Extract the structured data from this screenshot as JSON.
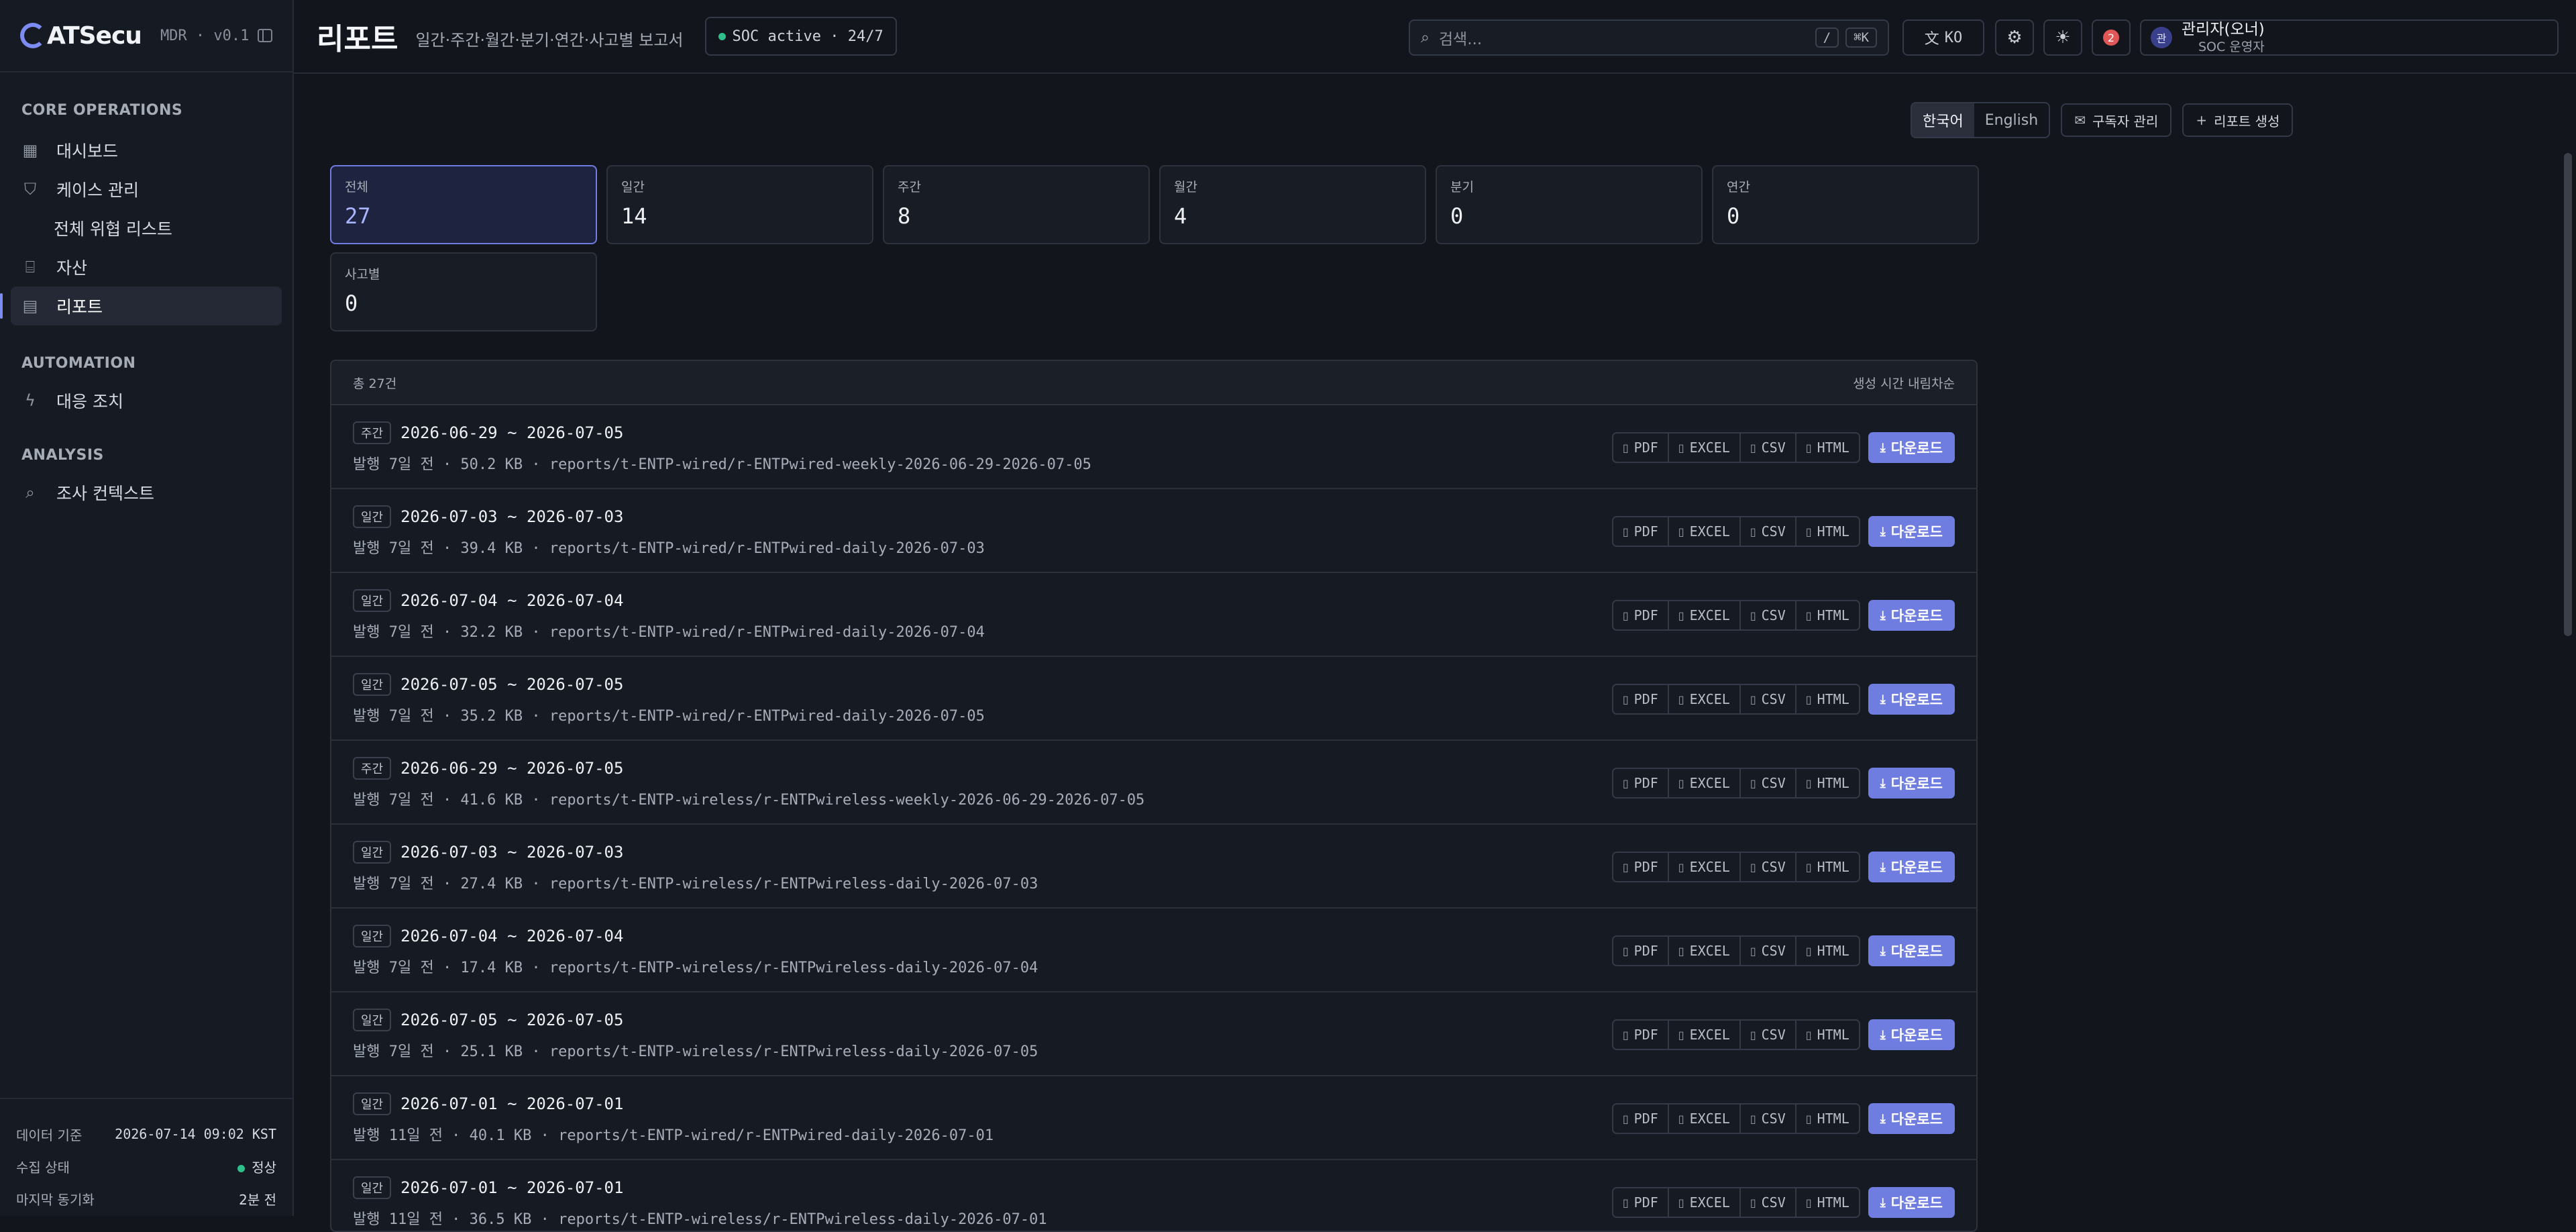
{
  "brand": {
    "name": "ATSecu",
    "version": "MDR · v0.1"
  },
  "sidebar": {
    "sections": [
      {
        "title": "CORE OPERATIONS"
      },
      {
        "title": "AUTOMATION"
      },
      {
        "title": "ANALYSIS"
      }
    ],
    "items": [
      {
        "label": "대시보드",
        "icon": "grid-icon"
      },
      {
        "label": "케이스 관리",
        "icon": "shield-icon"
      },
      {
        "label": "전체 위협 리스트"
      },
      {
        "label": "자산",
        "icon": "drive-icon"
      },
      {
        "label": "리포트",
        "icon": "report-icon",
        "active": true
      },
      {
        "label": "대응 조치",
        "icon": "bolt-icon"
      },
      {
        "label": "조사 컨텍스트",
        "icon": "search-icon"
      }
    ],
    "footer": {
      "data_label": "데이터 기준",
      "data_value": "2026-07-14 09:02 KST",
      "collect_label": "수집 상태",
      "collect_value": "정상",
      "sync_label": "마지막 동기화",
      "sync_value": "2분 전"
    }
  },
  "topbar": {
    "title": "리포트",
    "subtitle": "일간·주간·월간·분기·연간·사고별 보고서",
    "soc_badge": "SOC active · 24/7",
    "search_placeholder": "검색...",
    "kbd_slash": "/",
    "kbd_k": "⌘K",
    "lang_button": "KO",
    "notification_count": "2",
    "user_initial": "관",
    "user_name": "관리자(오너)",
    "user_role": "SOC 운영자"
  },
  "toolbar": {
    "lang_ko": "한국어",
    "lang_en": "English",
    "subscribe": "구독자 관리",
    "create": "리포트 생성"
  },
  "cards": [
    {
      "label": "전체",
      "value": "27",
      "selected": true
    },
    {
      "label": "일간",
      "value": "14"
    },
    {
      "label": "주간",
      "value": "8"
    },
    {
      "label": "월간",
      "value": "4"
    },
    {
      "label": "분기",
      "value": "0"
    },
    {
      "label": "연간",
      "value": "0"
    },
    {
      "label": "사고별",
      "value": "0"
    }
  ],
  "list": {
    "total": "총 27건",
    "sort": "생성 시간 내림차순",
    "formats": [
      "PDF",
      "EXCEL",
      "CSV",
      "HTML"
    ],
    "download": "다운로드",
    "rows": [
      {
        "type": "주간",
        "period": "2026-06-29 ~ 2026-07-05",
        "meta": "발행  7일 전  ·  50.2 KB  ·  reports/t-ENTP-wired/r-ENTPwired-weekly-2026-06-29-2026-07-05"
      },
      {
        "type": "일간",
        "period": "2026-07-03 ~ 2026-07-03",
        "meta": "발행  7일 전  ·  39.4 KB  ·  reports/t-ENTP-wired/r-ENTPwired-daily-2026-07-03"
      },
      {
        "type": "일간",
        "period": "2026-07-04 ~ 2026-07-04",
        "meta": "발행  7일 전  ·  32.2 KB  ·  reports/t-ENTP-wired/r-ENTPwired-daily-2026-07-04"
      },
      {
        "type": "일간",
        "period": "2026-07-05 ~ 2026-07-05",
        "meta": "발행  7일 전  ·  35.2 KB  ·  reports/t-ENTP-wired/r-ENTPwired-daily-2026-07-05"
      },
      {
        "type": "주간",
        "period": "2026-06-29 ~ 2026-07-05",
        "meta": "발행  7일 전  ·  41.6 KB  ·  reports/t-ENTP-wireless/r-ENTPwireless-weekly-2026-06-29-2026-07-05"
      },
      {
        "type": "일간",
        "period": "2026-07-03 ~ 2026-07-03",
        "meta": "발행  7일 전  ·  27.4 KB  ·  reports/t-ENTP-wireless/r-ENTPwireless-daily-2026-07-03"
      },
      {
        "type": "일간",
        "period": "2026-07-04 ~ 2026-07-04",
        "meta": "발행  7일 전  ·  17.4 KB  ·  reports/t-ENTP-wireless/r-ENTPwireless-daily-2026-07-04"
      },
      {
        "type": "일간",
        "period": "2026-07-05 ~ 2026-07-05",
        "meta": "발행  7일 전  ·  25.1 KB  ·  reports/t-ENTP-wireless/r-ENTPwireless-daily-2026-07-05"
      },
      {
        "type": "일간",
        "period": "2026-07-01 ~ 2026-07-01",
        "meta": "발행  11일 전  ·  40.1 KB  ·  reports/t-ENTP-wired/r-ENTPwired-daily-2026-07-01"
      },
      {
        "type": "일간",
        "period": "2026-07-01 ~ 2026-07-01",
        "meta": "발행  11일 전  ·  36.5 KB  ·  reports/t-ENTP-wireless/r-ENTPwireless-daily-2026-07-01"
      }
    ]
  },
  "colors": {
    "accent": "#6f7de0",
    "background": "#12151c",
    "status_ok": "#2fbf8a",
    "badge_red": "#e05757"
  }
}
